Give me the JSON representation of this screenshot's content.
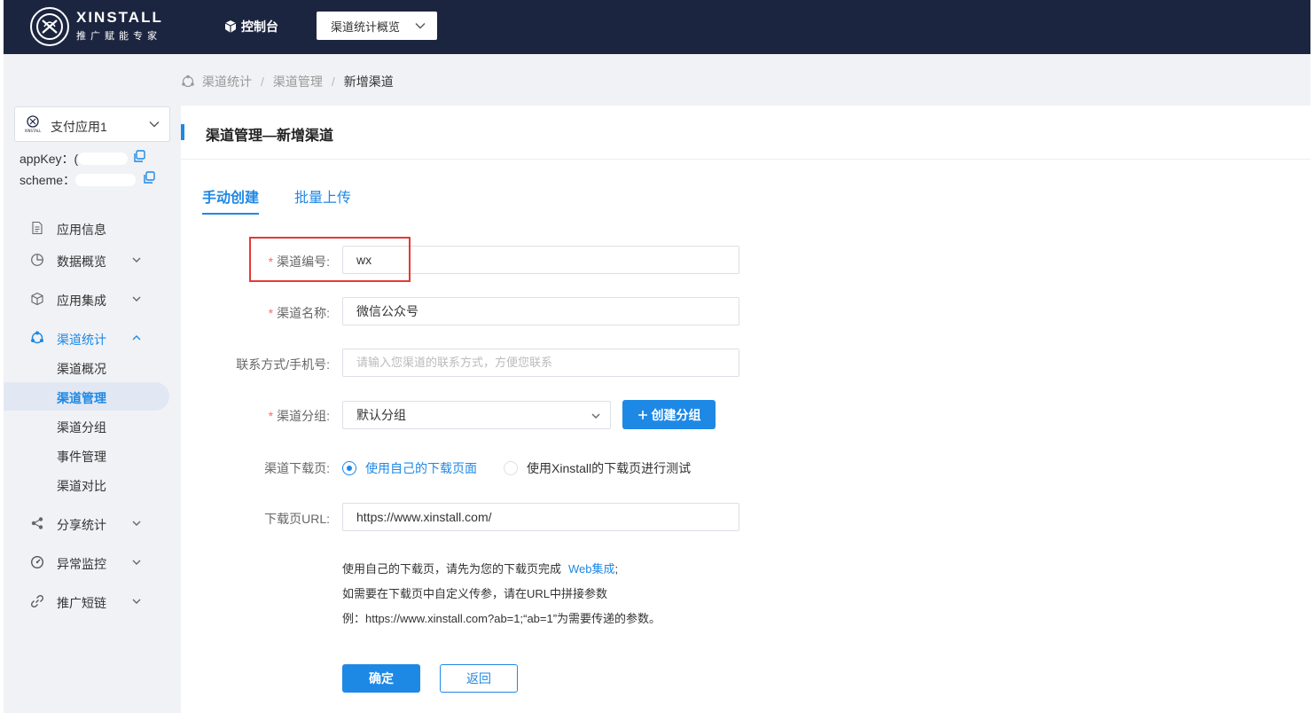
{
  "header": {
    "brand_name": "XINSTALL",
    "brand_tagline": "推广赋能专家",
    "console_label": "控制台",
    "top_select_value": "渠道统计概览"
  },
  "sidebar": {
    "app_name": "支付应用1",
    "app_logo_text": "XINSTALL",
    "app_key_label": "appKey：",
    "app_key_value_prefix": "(",
    "scheme_label": "scheme：",
    "items": [
      {
        "label": "应用信息",
        "icon": "document-icon",
        "expandable": false
      },
      {
        "label": "数据概览",
        "icon": "pie-chart-icon",
        "expandable": true
      },
      {
        "label": "应用集成",
        "icon": "cube-icon",
        "expandable": true
      },
      {
        "label": "渠道统计",
        "icon": "channel-icon",
        "expandable": true,
        "expanded": true
      },
      {
        "label": "分享统计",
        "icon": "share-icon",
        "expandable": true
      },
      {
        "label": "异常监控",
        "icon": "gauge-icon",
        "expandable": true
      },
      {
        "label": "推广短链",
        "icon": "link-icon",
        "expandable": true
      }
    ],
    "subitems": [
      "渠道概况",
      "渠道管理",
      "渠道分组",
      "事件管理",
      "渠道对比"
    ],
    "selected_subitem": "渠道管理"
  },
  "breadcrumb": {
    "items": [
      "渠道统计",
      "渠道管理"
    ],
    "current": "新增渠道",
    "separator": "/"
  },
  "page": {
    "title": "渠道管理—新增渠道",
    "tabs": [
      "手动创建",
      "批量上传"
    ],
    "active_tab": "手动创建"
  },
  "form": {
    "channel_code": {
      "label": "渠道编号:",
      "required": true,
      "value": "wx"
    },
    "channel_name": {
      "label": "渠道名称:",
      "required": true,
      "value": "微信公众号"
    },
    "contact": {
      "label": "联系方式/手机号:",
      "required": false,
      "value": "",
      "placeholder": "请输入您渠道的联系方式，方便您联系"
    },
    "group": {
      "label": "渠道分组:",
      "required": true,
      "value": "默认分组",
      "create_button": "创建分组"
    },
    "download_page": {
      "label": "渠道下载页:",
      "options": [
        "使用自己的下载页面",
        "使用Xinstall的下载页进行测试"
      ],
      "selected": "使用自己的下载页面"
    },
    "download_url": {
      "label": "下载页URL:",
      "value": "https://www.xinstall.com/"
    },
    "notes": {
      "line1": "使用自己的下载页，请先为您的下载页完成",
      "line1_link": "Web集成",
      "line1_suffix": ";",
      "line2": "如需要在下载页中自定义传参，请在URL中拼接参数",
      "line3": "例：https://www.xinstall.com?ab=1;“ab=1”为需要传递的参数。"
    },
    "confirm_button": "确定",
    "back_button": "返回"
  },
  "colors": {
    "primary": "#1e88e5",
    "header_bg": "#1c2540",
    "sidebar_bg": "#f0f2f5",
    "required_star": "#f56c6c",
    "highlight_box": "#e53935"
  }
}
